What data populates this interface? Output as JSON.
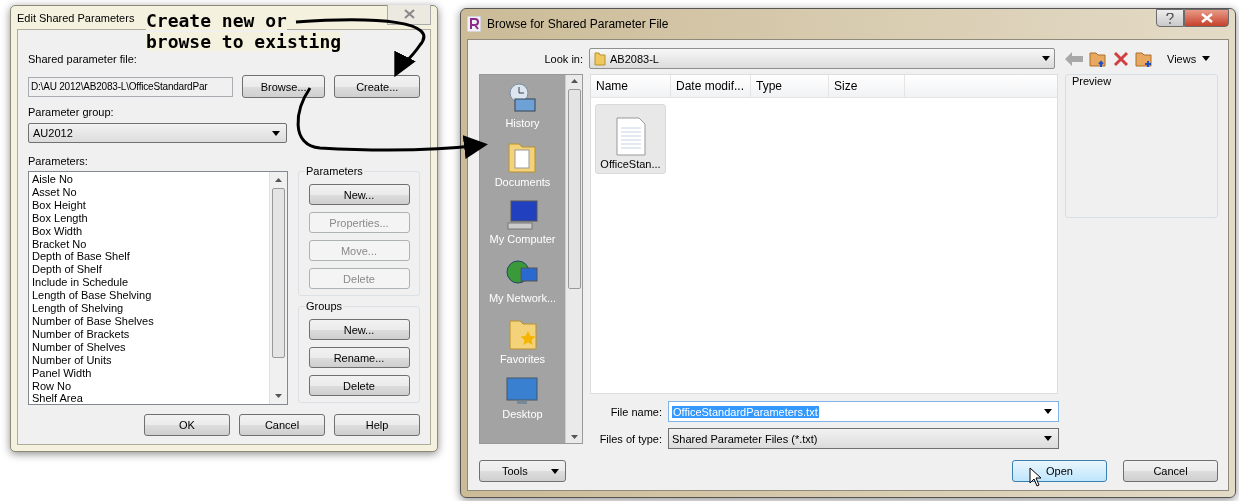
{
  "annotation": {
    "lines": [
      "Create new or",
      "browse to existing"
    ]
  },
  "edit_dialog": {
    "title": "Edit Shared Parameters",
    "file_label": "Shared parameter file:",
    "file_path": "D:\\AU 2012\\AB2083-L\\OfficeStandardPar",
    "browse_button": "Browse...",
    "create_button": "Create...",
    "group_label": "Parameter group:",
    "group_value": "AU2012",
    "parameters_label": "Parameters:",
    "parameters": [
      "Aisle No",
      "Asset No",
      "Box Height",
      "Box Length",
      "Box Width",
      "Bracket No",
      "Depth of Base Shelf",
      "Depth of Shelf",
      "Include in Schedule",
      "Length of Base Shelving",
      "Length of Shelving",
      "Number of Base Shelves",
      "Number of Brackets",
      "Number of Shelves",
      "Number of Units",
      "Panel Width",
      "Row No",
      "Shelf Area"
    ],
    "button_groups": [
      {
        "title": "Parameters",
        "buttons": [
          {
            "label": "New...",
            "disabled": false
          },
          {
            "label": "Properties...",
            "disabled": true
          },
          {
            "label": "Move...",
            "disabled": true
          },
          {
            "label": "Delete",
            "disabled": true
          }
        ]
      },
      {
        "title": "Groups",
        "buttons": [
          {
            "label": "New...",
            "disabled": false
          },
          {
            "label": "Rename...",
            "disabled": false
          },
          {
            "label": "Delete",
            "disabled": false
          }
        ]
      }
    ],
    "footer_buttons": [
      "OK",
      "Cancel",
      "Help"
    ]
  },
  "browse_dialog": {
    "title": "Browse for Shared Parameter File",
    "look_in_label": "Look in:",
    "look_in_value": "AB2083-L",
    "views_label": "Views",
    "places": [
      {
        "label": "History",
        "kind": "history"
      },
      {
        "label": "Documents",
        "kind": "documents"
      },
      {
        "label": "My Computer",
        "kind": "computer"
      },
      {
        "label": "My Network...",
        "kind": "network"
      },
      {
        "label": "Favorites",
        "kind": "favorites"
      },
      {
        "label": "Desktop",
        "kind": "desktop"
      }
    ],
    "columns": [
      "Name",
      "Date modif...",
      "Type",
      "Size"
    ],
    "files": [
      {
        "name": "OfficeStan...",
        "selected": true
      }
    ],
    "preview_label": "Preview",
    "file_name_label": "File name:",
    "file_name_value": "OfficeStandardParameters.txt",
    "file_type_label": "Files of type:",
    "file_type_value": "Shared Parameter Files (*.txt)",
    "tools_button": "Tools",
    "open_button": "Open",
    "cancel_button": "Cancel"
  }
}
